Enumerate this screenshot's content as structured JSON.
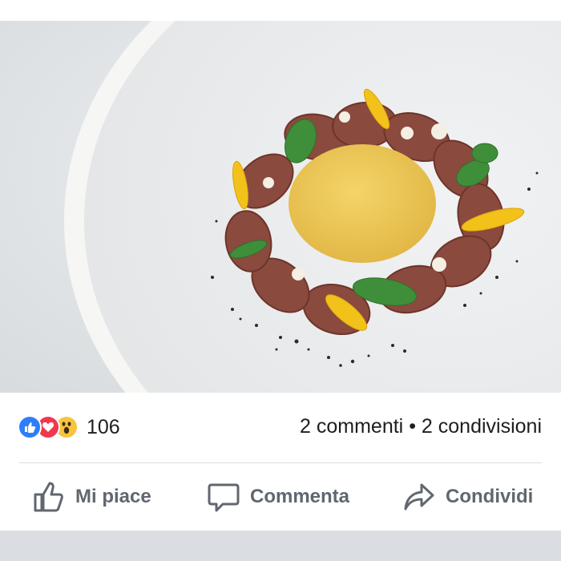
{
  "post": {
    "photo": {
      "alt": "plated dish",
      "subject_icon": "food-photo"
    },
    "reactions": {
      "icons": [
        "like-icon",
        "love-icon",
        "wow-icon"
      ],
      "count": "106"
    },
    "stats": {
      "comments": "2 commenti",
      "separator": "•",
      "shares": "2 condivisioni"
    },
    "actions": {
      "like": {
        "label": "Mi piace",
        "icon": "thumbs-up-icon"
      },
      "comment": {
        "label": "Commenta",
        "icon": "comment-icon"
      },
      "share": {
        "label": "Condividi",
        "icon": "share-icon"
      }
    }
  },
  "colors": {
    "like": "#2d7ff9",
    "love": "#f0384f",
    "wow": "#f6c53d",
    "action_text": "#606770",
    "divider": "#dadde1"
  }
}
